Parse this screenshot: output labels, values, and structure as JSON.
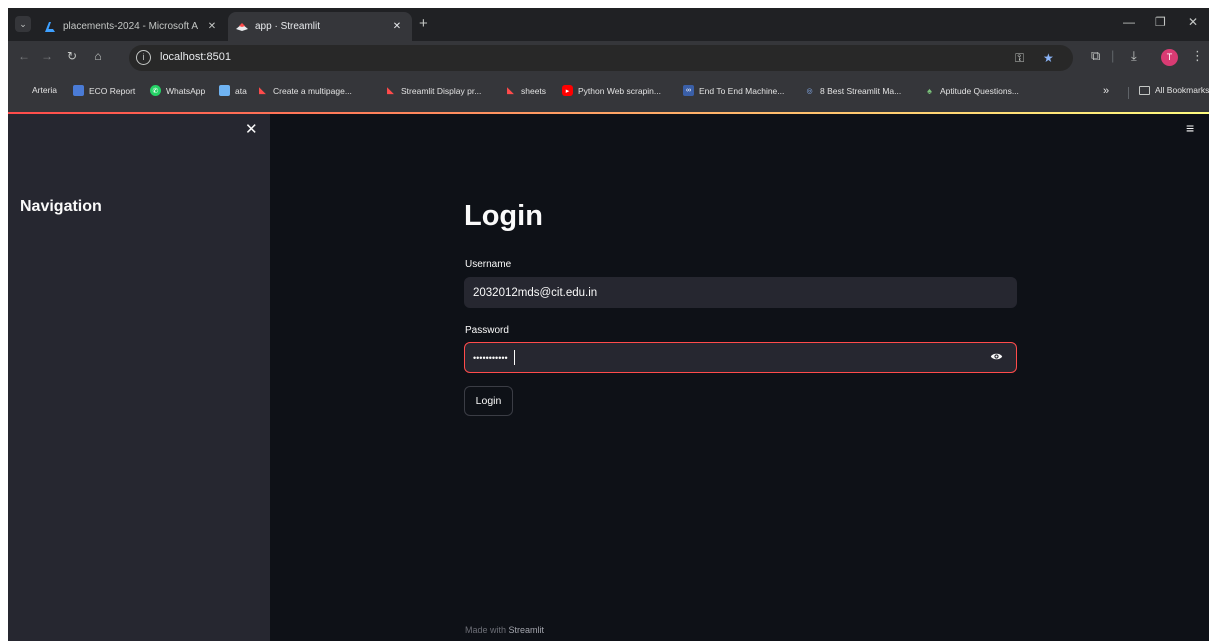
{
  "browser": {
    "tabs": [
      {
        "title": "placements-2024 - Microsoft A",
        "active": false
      },
      {
        "title": "app · Streamlit",
        "active": true
      }
    ],
    "url": "localhost:8501",
    "avatar_initial": "T",
    "bookmarks": [
      {
        "label": "Arteria",
        "icon": "none"
      },
      {
        "label": "ECO Report",
        "icon": "report-icon"
      },
      {
        "label": "WhatsApp",
        "icon": "whatsapp-icon"
      },
      {
        "label": "ata",
        "icon": "ata-icon"
      },
      {
        "label": "Create a multipage...",
        "icon": "streamlit-icon"
      },
      {
        "label": "Streamlit Display pr...",
        "icon": "streamlit-icon"
      },
      {
        "label": "sheets",
        "icon": "streamlit-icon"
      },
      {
        "label": "Python Web scrapin...",
        "icon": "youtube-icon"
      },
      {
        "label": "End To End Machine...",
        "icon": "colab-icon"
      },
      {
        "label": "8 Best Streamlit Ma...",
        "icon": "article-icon"
      },
      {
        "label": "Aptitude Questions...",
        "icon": "aptitude-icon"
      }
    ],
    "more_bookmarks": "»",
    "all_bookmarks": "All Bookmarks"
  },
  "sidebar": {
    "title": "Navigation"
  },
  "login": {
    "title": "Login",
    "username_label": "Username",
    "username_value": "2032012mds@cit.edu.in",
    "password_label": "Password",
    "password_value": "•••••••••••",
    "button_label": "Login"
  },
  "footer": {
    "prefix": "Made with",
    "brand": "Streamlit"
  },
  "colors": {
    "primary": "#ff4b4b",
    "app_background": "#0e1117",
    "sidebar_background": "#262730"
  }
}
